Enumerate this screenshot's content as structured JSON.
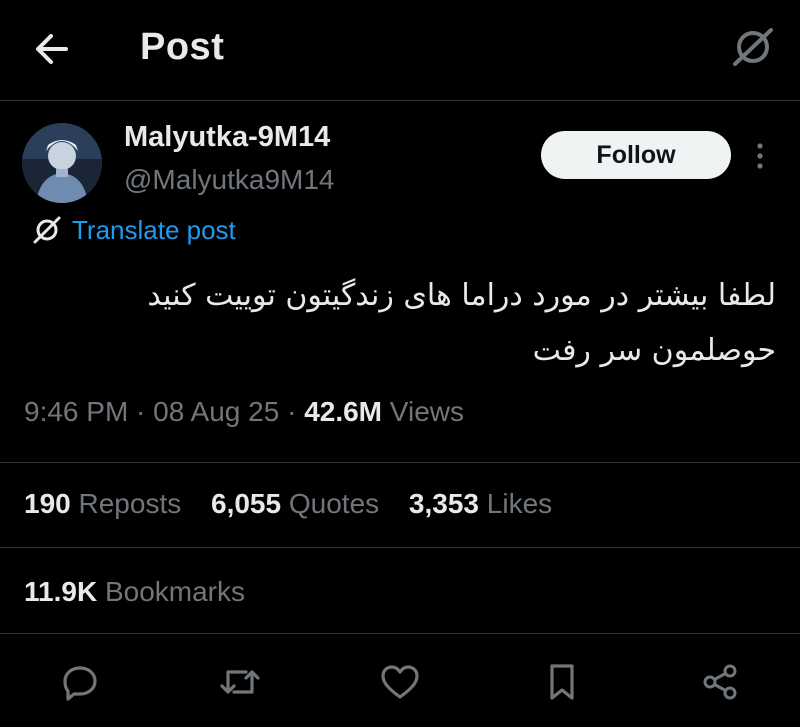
{
  "header": {
    "title": "Post",
    "back_icon": "arrow-left-icon",
    "translate_icon": "translate-icon"
  },
  "author": {
    "name": "Malyutka-9M14",
    "handle": "@Malyutka9M14",
    "follow_label": "Follow",
    "more_icon": "more-vertical-icon"
  },
  "translate": {
    "label": "Translate post"
  },
  "post": {
    "text_line1": "لطفا بیشتر در مورد دراما های زندگیتون توییت کنید",
    "text_line2": "حوصلمون سر رفت"
  },
  "meta": {
    "time": "9:46 PM",
    "sep1": " · ",
    "date": "08 Aug 25",
    "sep2": " · ",
    "views_count": "42.6M",
    "views_label": "Views"
  },
  "stats": {
    "reposts_count": "190",
    "reposts_label": "Reposts",
    "quotes_count": "6,055",
    "quotes_label": "Quotes",
    "likes_count": "3,353",
    "likes_label": "Likes",
    "bookmarks_count": "11.9K",
    "bookmarks_label": "Bookmarks"
  },
  "actions": [
    "reply-icon",
    "repost-icon",
    "like-icon",
    "bookmark-icon",
    "share-icon"
  ],
  "colors": {
    "background": "#000000",
    "text": "#e7e9ea",
    "muted": "#71767b",
    "link": "#1d9bf0",
    "divider": "#2f3336",
    "follow_bg": "#eff3f4"
  }
}
